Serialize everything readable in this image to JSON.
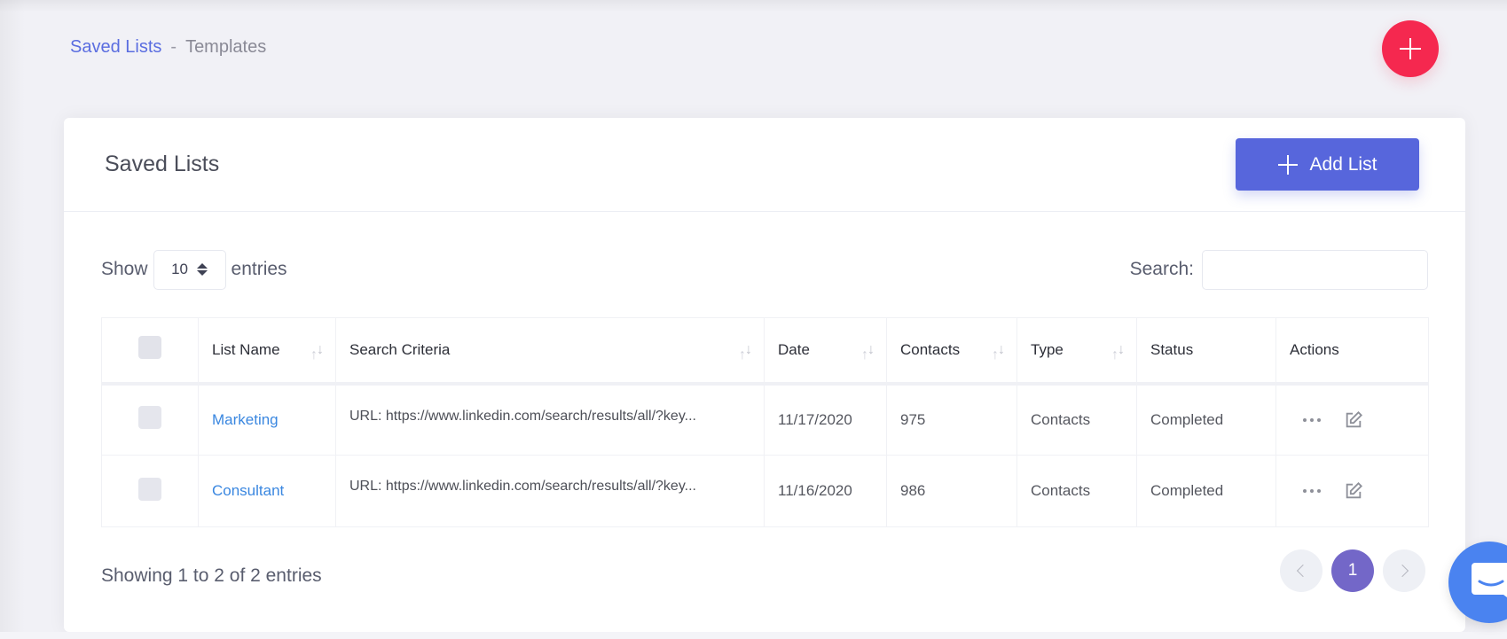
{
  "breadcrumb": {
    "parent": "Saved Lists",
    "separator": "-",
    "current": "Templates"
  },
  "fab": {
    "icon": "plus-icon",
    "color": "#f5284f"
  },
  "card": {
    "title": "Saved Lists",
    "add_button_label": "Add List",
    "add_button_color": "#5766dc"
  },
  "controls": {
    "show_label": "Show",
    "entries_value": "10",
    "entries_label": "entries",
    "search_label": "Search:",
    "search_value": "",
    "search_placeholder": ""
  },
  "table": {
    "columns": [
      "",
      "List Name",
      "Search Criteria",
      "Date",
      "Contacts",
      "Type",
      "Status",
      "Actions"
    ],
    "sortable": [
      false,
      true,
      true,
      true,
      true,
      true,
      false,
      false
    ],
    "rows": [
      {
        "list_name": "Marketing",
        "search_criteria": "URL: https://www.linkedin.com/search/results/all/?key...",
        "date": "11/17/2020",
        "contacts": "975",
        "type": "Contacts",
        "status": "Completed"
      },
      {
        "list_name": "Consultant",
        "search_criteria": "URL: https://www.linkedin.com/search/results/all/?key...",
        "date": "11/16/2020",
        "contacts": "986",
        "type": "Contacts",
        "status": "Completed"
      }
    ]
  },
  "footer": {
    "info": "Showing 1 to 2 of 2 entries",
    "current_page": "1"
  },
  "colors": {
    "link": "#3a87e0",
    "breadcrumb_link": "#5a6de0",
    "active_page": "#7367c8",
    "chat": "#4a83f0"
  }
}
